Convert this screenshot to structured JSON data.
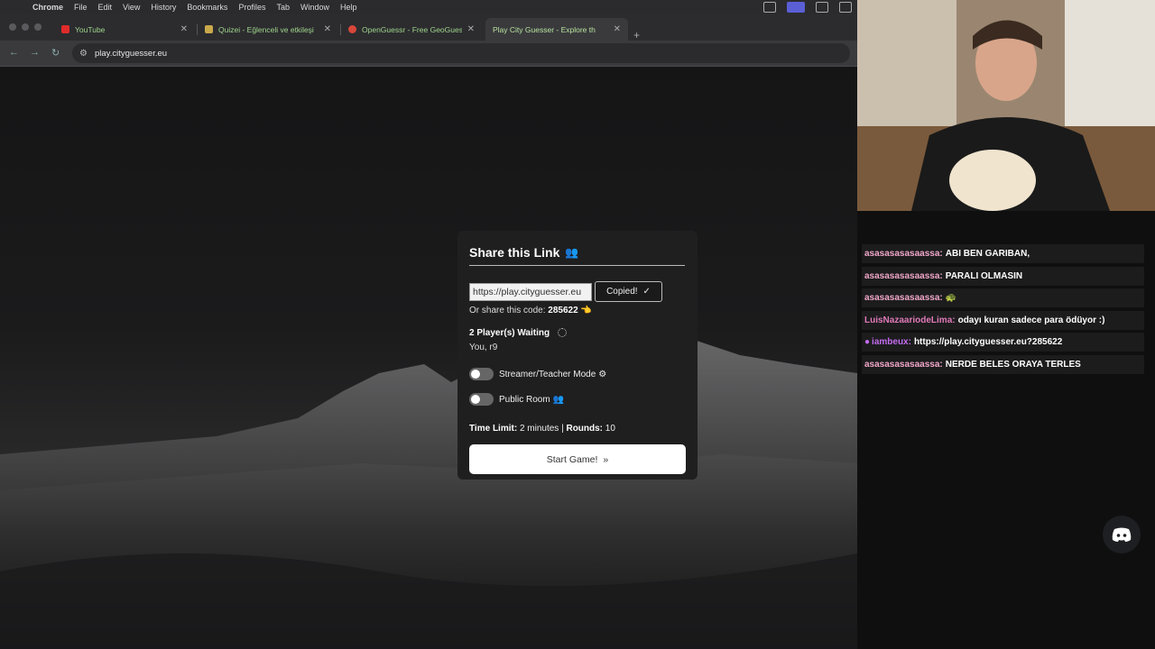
{
  "menubar": {
    "app": "Chrome",
    "items": [
      "File",
      "Edit",
      "View",
      "History",
      "Bookmarks",
      "Profiles",
      "Tab",
      "Window",
      "Help"
    ]
  },
  "tabs": [
    {
      "title": "YouTube",
      "favicon_color": "#e02b2b"
    },
    {
      "title": "Quizei - Eğlenceli ve etkileşi",
      "favicon_color": "#c9a94a"
    },
    {
      "title": "OpenGuessr - Free GeoGuess",
      "favicon_color": "#d8473a"
    },
    {
      "title": "Play City Guesser - Explore th",
      "favicon_color": "#3a3a3d",
      "active": true
    }
  ],
  "address": {
    "url": "play.cityguesser.eu"
  },
  "share": {
    "title": "Share this Link",
    "link_value": "https://play.cityguesser.eu",
    "copied_label": "Copied!",
    "code_prefix": "Or share this code:",
    "code": "285622",
    "waiting": "2 Player(s) Waiting",
    "players": "You, r9",
    "streamer_mode": "Streamer/Teacher Mode",
    "public_room": "Public Room",
    "time_limit_label": "Time Limit:",
    "time_limit_value": "2 minutes",
    "rounds_label": "Rounds:",
    "rounds_value": "10",
    "start_label": "Start Game!"
  },
  "chat": [
    {
      "user": "asasasasasaassa:",
      "text": "ABI BEN GARIBAN,",
      "color": "#f1a7c9"
    },
    {
      "user": "asasasasasaassa:",
      "text": "PARALI OLMASIN",
      "color": "#f1a7c9"
    },
    {
      "user": "asasasasasaassa:",
      "text": "🐢",
      "color": "#f1a7c9"
    },
    {
      "user": "LuisNazaariodeLima:",
      "text": "odayı kuran sadece para ödüyor :)",
      "color": "#e07ab8"
    },
    {
      "user": "iambeux:",
      "text": "https://play.cityguesser.eu?285622",
      "color": "#c46cf0"
    },
    {
      "user": "asasasasasaassa:",
      "text": "NERDE BELES ORAYA TERLES",
      "color": "#f1a7c9"
    }
  ]
}
